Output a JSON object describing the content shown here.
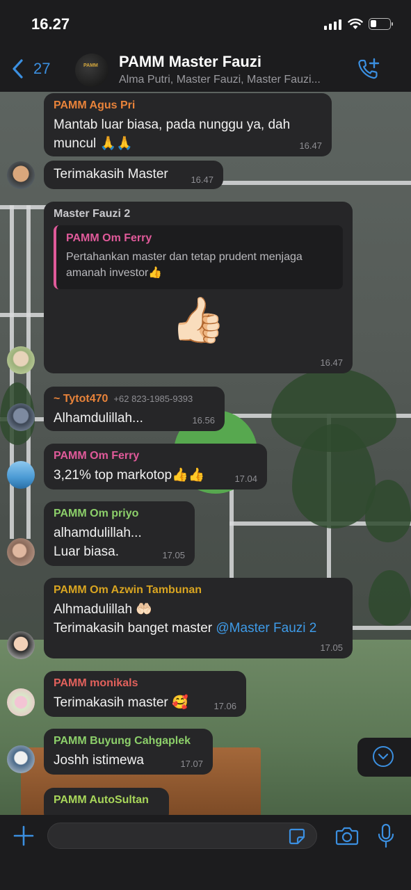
{
  "status_bar": {
    "time": "16.27"
  },
  "header": {
    "back_count": "27",
    "title": "PAMM Master Fauzi",
    "subtitle": "Alma Putri, Master Fauzi, Master Fauzi...",
    "avatar_text": "PAMM"
  },
  "colors": {
    "accent": "#3b8fe0",
    "bubble": "#262628",
    "bar": "#1c1c1e",
    "sender_orange": "#e8833a",
    "sender_pink": "#e05a9a",
    "sender_green": "#8ccf6a",
    "sender_gold": "#d9a521",
    "sender_red": "#e2615c",
    "sender_lime": "#a8d65a"
  },
  "messages": [
    {
      "sender": "PAMM Agus Pri",
      "text_line1": "Mantab luar biasa, pada nunggu ya, dah",
      "text_line2": "muncul 🙏🙏",
      "time": "16.47"
    },
    {
      "sender": "",
      "text": "Terimakasih Master",
      "time": "16.47"
    },
    {
      "sender": "Master Fauzi 2",
      "quote_sender": "PAMM Om Ferry",
      "quote_line1": "Pertahankan master dan tetap prudent menjaga",
      "quote_line2": "amanah investor👍",
      "text": "👍🏻",
      "time": "16.47"
    },
    {
      "sender": "~ Tytot470",
      "phone": "+62 823-1985-9393",
      "text": "Alhamdulillah...",
      "time": "16.56"
    },
    {
      "sender": "PAMM Om Ferry",
      "text": "3,21% top markotop👍👍",
      "time": "17.04"
    },
    {
      "sender": "PAMM Om priyo",
      "text_line1": "alhamdulillah...",
      "text_line2": "Luar biasa.",
      "time": "17.05"
    },
    {
      "sender": "PAMM Om Azwin Tambunan",
      "text_line1": "Alhmadulillah 🤲🏻",
      "text_line2_prefix": "Terimakasih banget master ",
      "mention": "@Master Fauzi 2",
      "time": "17.05"
    },
    {
      "sender": "PAMM monikals",
      "text": "Terimakasih master 🥰",
      "time": "17.06"
    },
    {
      "sender": "PAMM Buyung Cahgaplek",
      "text": "Joshh istimewa",
      "time": "17.07"
    },
    {
      "sender": "PAMM AutoSultan"
    }
  ],
  "input": {
    "placeholder": "",
    "value": ""
  }
}
